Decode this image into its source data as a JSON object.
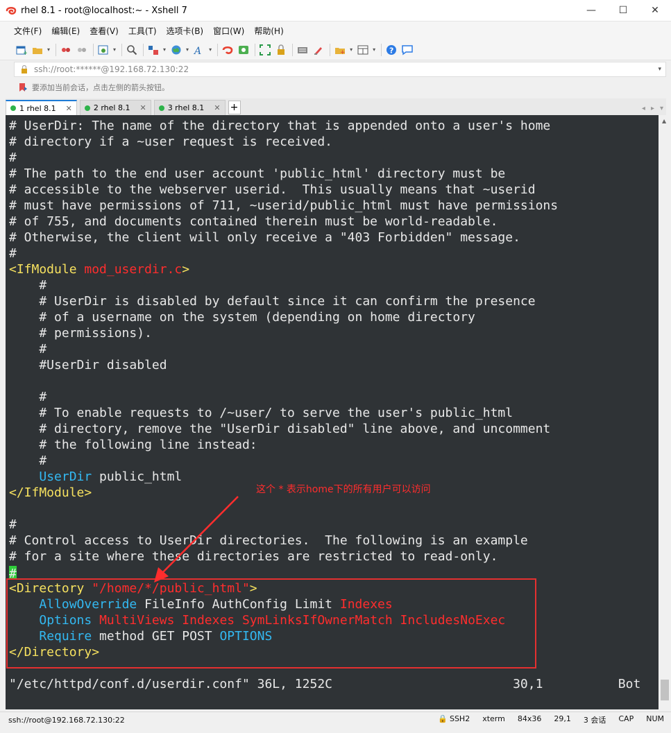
{
  "window": {
    "title": "rhel 8.1 - root@localhost:~ - Xshell 7",
    "minimize": "—",
    "maximize": "☐",
    "close": "✕",
    "brand_color": "#e8402f"
  },
  "menu": {
    "items": [
      "文件(F)",
      "编辑(E)",
      "查看(V)",
      "工具(T)",
      "选项卡(B)",
      "窗口(W)",
      "帮助(H)"
    ]
  },
  "address": {
    "value": "ssh://root:******@192.168.72.130:22"
  },
  "hint": {
    "text": "要添加当前会话，点击左侧的箭头按钮。"
  },
  "tabs": [
    {
      "label": "1 rhel 8.1",
      "active": true,
      "close": "✕"
    },
    {
      "label": "2 rhel 8.1",
      "active": false,
      "close": "✕"
    },
    {
      "label": "3 rhel 8.1",
      "active": false,
      "close": "✕"
    }
  ],
  "tab_add": "+",
  "tab_nav": {
    "prev": "◂",
    "next": "▸",
    "menu": "▾"
  },
  "terminal": {
    "lines": [
      [
        {
          "t": "# UserDir: The name of the directory that is appended onto a user's home",
          "c": "c-comment"
        }
      ],
      [
        {
          "t": "# directory if a ~user request is received.",
          "c": "c-comment"
        }
      ],
      [
        {
          "t": "#",
          "c": "c-comment"
        }
      ],
      [
        {
          "t": "# The path to the end user account 'public_html' directory must be",
          "c": "c-comment"
        }
      ],
      [
        {
          "t": "# accessible to the webserver userid.  This usually means that ~userid",
          "c": "c-comment"
        }
      ],
      [
        {
          "t": "# must have permissions of 711, ~userid/public_html must have permissions",
          "c": "c-comment"
        }
      ],
      [
        {
          "t": "# of 755, and documents contained therein must be world-readable.",
          "c": "c-comment"
        }
      ],
      [
        {
          "t": "# Otherwise, the client will only receive a \"403 Forbidden\" message.",
          "c": "c-comment"
        }
      ],
      [
        {
          "t": "#",
          "c": "c-comment"
        }
      ],
      [
        {
          "t": "<IfModule ",
          "c": "c-tag"
        },
        {
          "t": "mod_userdir.c",
          "c": "c-red"
        },
        {
          "t": ">",
          "c": "c-tag"
        }
      ],
      [
        {
          "t": "    #",
          "c": "c-comment"
        }
      ],
      [
        {
          "t": "    # UserDir is disabled by default since it can confirm the presence",
          "c": "c-comment"
        }
      ],
      [
        {
          "t": "    # of a username on the system (depending on home directory",
          "c": "c-comment"
        }
      ],
      [
        {
          "t": "    # permissions).",
          "c": "c-comment"
        }
      ],
      [
        {
          "t": "    #",
          "c": "c-comment"
        }
      ],
      [
        {
          "t": "    #UserDir disabled",
          "c": "c-comment"
        }
      ],
      [
        {
          "t": "",
          "c": "c-plain"
        }
      ],
      [
        {
          "t": "    #",
          "c": "c-comment"
        }
      ],
      [
        {
          "t": "    # To enable requests to /~user/ to serve the user's public_html",
          "c": "c-comment"
        }
      ],
      [
        {
          "t": "    # directory, remove the \"UserDir disabled\" line above, and uncomment",
          "c": "c-comment"
        }
      ],
      [
        {
          "t": "    # the following line instead:",
          "c": "c-comment"
        }
      ],
      [
        {
          "t": "    #",
          "c": "c-comment"
        }
      ],
      [
        {
          "t": "    ",
          "c": "c-plain"
        },
        {
          "t": "UserDir",
          "c": "c-dir"
        },
        {
          "t": " public_html",
          "c": "c-plain"
        }
      ],
      [
        {
          "t": "</IfModule>",
          "c": "c-tag"
        }
      ],
      [
        {
          "t": "",
          "c": "c-plain"
        }
      ],
      [
        {
          "t": "#",
          "c": "c-comment"
        }
      ],
      [
        {
          "t": "# Control access to UserDir directories.  The following is an example",
          "c": "c-comment"
        }
      ],
      [
        {
          "t": "# for a site where these directories are restricted to read-only.",
          "c": "c-comment"
        }
      ],
      [
        {
          "t": "#",
          "c": "cursor"
        }
      ],
      [
        {
          "t": "<Directory ",
          "c": "c-tag"
        },
        {
          "t": "\"/home/*/public_html\"",
          "c": "c-red"
        },
        {
          "t": ">",
          "c": "c-tag"
        }
      ],
      [
        {
          "t": "    ",
          "c": "c-plain"
        },
        {
          "t": "AllowOverride",
          "c": "c-dir"
        },
        {
          "t": " FileInfo AuthConfig Limit ",
          "c": "c-plain"
        },
        {
          "t": "Indexes",
          "c": "c-red"
        }
      ],
      [
        {
          "t": "    ",
          "c": "c-plain"
        },
        {
          "t": "Options",
          "c": "c-dir"
        },
        {
          "t": " ",
          "c": "c-plain"
        },
        {
          "t": "MultiViews Indexes SymLinksIfOwnerMatch IncludesNoExec",
          "c": "c-red"
        }
      ],
      [
        {
          "t": "    ",
          "c": "c-plain"
        },
        {
          "t": "Require",
          "c": "c-dir"
        },
        {
          "t": " method GET POST ",
          "c": "c-plain"
        },
        {
          "t": "OPTIONS",
          "c": "c-dir"
        }
      ],
      [
        {
          "t": "</Directory>",
          "c": "c-tag"
        }
      ],
      [
        {
          "t": "",
          "c": "c-plain"
        }
      ],
      [
        {
          "t": "\"/etc/httpd/conf.d/userdir.conf\" 36L, 1252C                        30,1          Bot",
          "c": "c-plain"
        }
      ]
    ],
    "bg": "#2f3336"
  },
  "annotation": {
    "text": "这个 * 表示home下的所有用户可以访问",
    "color": "#ff2d2d"
  },
  "status": {
    "connection": "ssh://root@192.168.72.130:22",
    "protocol": "SSH2",
    "terminal_type": "xterm",
    "size": "84x36",
    "position": "29,1",
    "sessions": "3 会话",
    "caps": "CAP",
    "num": "NUM"
  }
}
